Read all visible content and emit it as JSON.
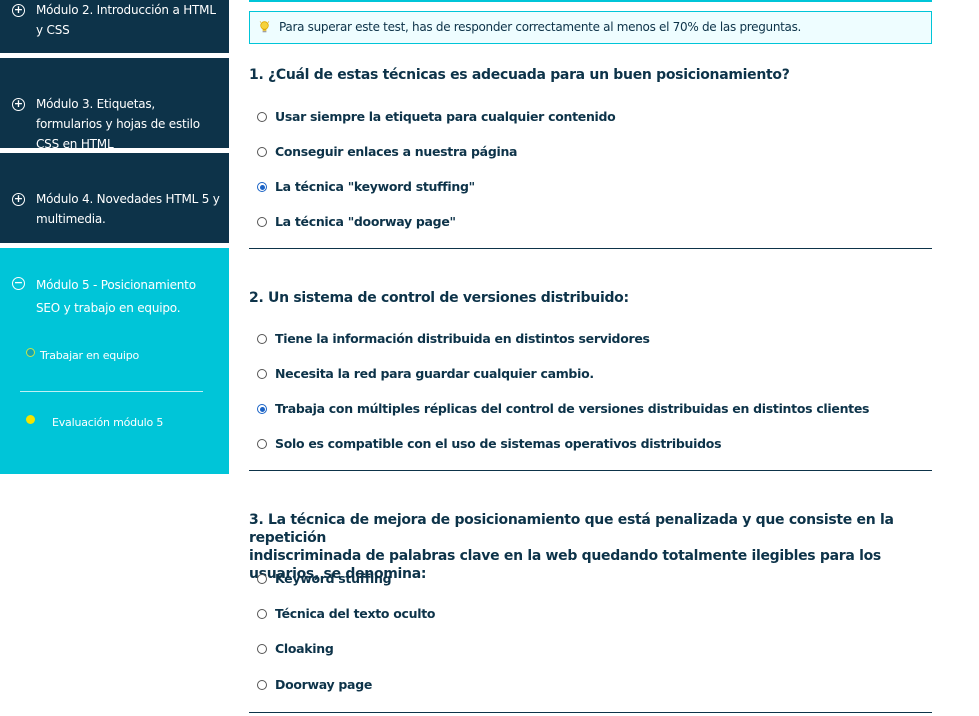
{
  "sidebar": {
    "modules": [
      {
        "title": "Módulo 2. Introducción a HTML y CSS",
        "active": false
      },
      {
        "title": "Módulo 3. Etiquetas, formularios y hojas de estilo CSS en HTML",
        "active": false
      },
      {
        "title": "Módulo 4. Novedades HTML 5 y multimedia.",
        "active": false
      },
      {
        "title": "Módulo 5 - Posicionamiento SEO y trabajo en equipo.",
        "active": true
      }
    ],
    "subitems": [
      {
        "label": "Trabajar en equipo",
        "status": "in-progress"
      },
      {
        "label": "Evaluación módulo 5",
        "status": "current"
      }
    ]
  },
  "hint": {
    "icon": "lightbulb-icon",
    "text": "Para superar este test, has de responder correctamente al menos el 70% de las preguntas."
  },
  "questions": [
    {
      "title": "1. ¿Cuál de estas técnicas es adecuada para un buen posicionamiento?",
      "options": [
        {
          "label": "Usar siempre la etiqueta para cualquier contenido",
          "selected": false
        },
        {
          "label": "Conseguir enlaces a nuestra página",
          "selected": false
        },
        {
          "label": "La técnica \"keyword stuffing\"",
          "selected": true
        },
        {
          "label": "La técnica \"doorway page\"",
          "selected": false
        }
      ]
    },
    {
      "title": "2. Un sistema de control de versiones distribuido:",
      "options": [
        {
          "label": "Tiene la información distribuida en distintos servidores",
          "selected": false
        },
        {
          "label": "Necesita la red para guardar cualquier cambio.",
          "selected": false
        },
        {
          "label": "Trabaja con múltiples réplicas del control de versiones distribuidas en distintos clientes",
          "selected": true
        },
        {
          "label": "Solo es compatible con el uso de sistemas operativos distribuidos",
          "selected": false
        }
      ]
    },
    {
      "title_line1": "3. La técnica de mejora de posicionamiento que está penalizada y que consiste en la repetición",
      "title_line2": "indiscriminada de palabras clave en la web quedando totalmente ilegibles para los usuarios, se denomina:",
      "options": [
        {
          "label": "Keyword stuffing",
          "selected": false
        },
        {
          "label": "Técnica del texto oculto",
          "selected": false
        },
        {
          "label": "Cloaking",
          "selected": false
        },
        {
          "label": "Doorway page",
          "selected": false
        }
      ]
    }
  ],
  "colors": {
    "sidebar_dark": "#0d3349",
    "sidebar_active": "#00c5d8",
    "accent": "#00c5d8",
    "radio_selected": "#1a63c6",
    "progress_dot_green": "#8bc34a",
    "progress_dot_yellow": "#f4e400"
  }
}
